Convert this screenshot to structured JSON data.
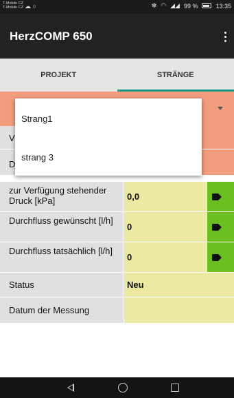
{
  "status_bar": {
    "carrier_line1": "T-Mobile CZ",
    "carrier_line2": "T-Mobile CZ",
    "battery_percent": "99 %",
    "time": "13:35"
  },
  "app_bar": {
    "title": "HerzCOMP 650",
    "menu_icon": "overflow-menu-icon"
  },
  "tabs": [
    {
      "label": "PROJEKT",
      "active": false
    },
    {
      "label": "STRÄNGE",
      "active": true
    }
  ],
  "dropdown": {
    "options": [
      "Strang1",
      "strang 3"
    ]
  },
  "table": {
    "rows": [
      {
        "label": "V",
        "value": ""
      },
      {
        "label": "D",
        "value": ""
      },
      {
        "label": "zur Verfügung stehender Druck [kPa]",
        "value": "0,0"
      },
      {
        "label": "Durchfluss gewünscht [l/h]",
        "value": "0"
      },
      {
        "label": "Durchfluss tatsächlich [l/h]",
        "value": "0"
      },
      {
        "label": "Status",
        "value": "Neu"
      },
      {
        "label": "Datum der Messung",
        "value": ""
      }
    ]
  },
  "colors": {
    "app_bar": "#222222",
    "tab_indicator": "#1a9a8a",
    "orange": "#f29c7e",
    "yellow": "#eceaa2",
    "green_button": "#6cbf20"
  }
}
